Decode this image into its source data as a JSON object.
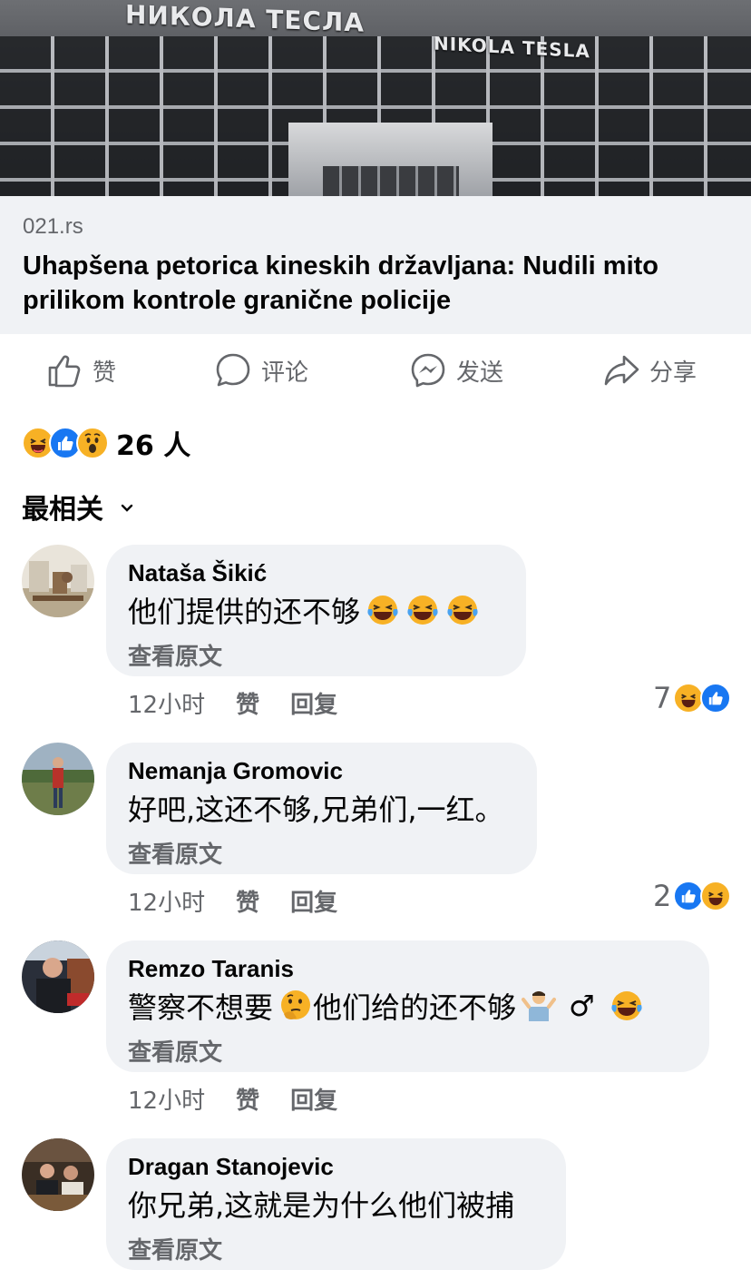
{
  "link_preview": {
    "sign_cyrillic": "НИКОЛА ТЕСЛА",
    "sign_latin": "NIKOLA TESLA",
    "domain": "021.rs",
    "headline": "Uhapšena petorica kineskih državljana: Nudili mito prilikom kontrole granične policije"
  },
  "actions": {
    "like": "赞",
    "comment": "评论",
    "send": "发送",
    "share": "分享"
  },
  "reactions": {
    "count": "26 人",
    "types": [
      "haha-icon",
      "like-icon",
      "wow-icon"
    ]
  },
  "sort": {
    "label": "最相关"
  },
  "comments": [
    {
      "name": "Nataša Šikić",
      "text": "他们提供的还不够",
      "emojis": [
        "laugh-cry-icon",
        "laugh-cry-icon",
        "laugh-cry-icon"
      ],
      "translate": "查看原文",
      "time": "12小时",
      "like": "赞",
      "reply": "回复",
      "reaction_count": "7",
      "reaction_types": [
        "haha-icon",
        "like-icon"
      ]
    },
    {
      "name": "Nemanja Gromovic",
      "text": "好吧,这还不够,兄弟们,一红。",
      "translate": "查看原文",
      "time": "12小时",
      "like": "赞",
      "reply": "回复",
      "reaction_count": "2",
      "reaction_types": [
        "like-icon",
        "haha-icon"
      ]
    },
    {
      "name": "Remzo Taranis",
      "text_a": "警察不想要",
      "text_b": " 他们给的还不够",
      "text_c": "♂",
      "emojis": [
        "thinking-face-icon",
        "shrug-icon",
        "laugh-cry-icon"
      ],
      "translate": "查看原文",
      "time": "12小时",
      "like": "赞",
      "reply": "回复"
    },
    {
      "name": "Dragan Stanojevic",
      "text": "你兄弟,这就是为什么他们被捕",
      "translate": "查看原文"
    }
  ],
  "colors": {
    "accent": "#1877f2",
    "secondary_text": "#65676b",
    "bubble": "#f0f2f5",
    "emoji_yellow": "#f7b125"
  }
}
